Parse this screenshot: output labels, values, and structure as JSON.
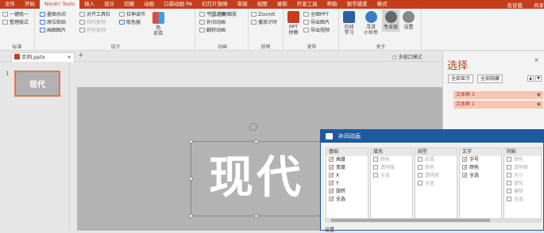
{
  "menu": {
    "tabs": [
      "文件",
      "开始",
      "Nordri Tools",
      "插入",
      "设计",
      "切换",
      "动画",
      "口袋动画 PA",
      "幻灯片放映",
      "审阅",
      "视图",
      "录制",
      "开发工具",
      "帮助",
      "银币猎爱",
      "格式"
    ],
    "active_index": 2,
    "tell_me": "告诉我",
    "share": "共享"
  },
  "ribbon": {
    "g1": {
      "label": "标准",
      "items": [
        "一键统一",
        "整理版式"
      ]
    },
    "g2": {
      "label": "设计",
      "items": [
        "墨图水印",
        "原位粘贴",
        "画图图片",
        "对齐工具栏",
        "矩阵复制",
        "环形复制",
        "拉伸调节",
        "取色器"
      ],
      "big": "色\n彩库"
    },
    "g3": {
      "label": "动画",
      "items": [
        "平滑过渡",
        "补间动画",
        "翻转动画",
        "时间缩放"
      ]
    },
    "g4": {
      "label": "放映",
      "items": [
        "ZoomIt",
        "播放计时"
      ]
    },
    "g5": {
      "label": "发布",
      "big": "PPT\n拼图",
      "items": [
        "全图PPT",
        "导出图片",
        "导出视频"
      ]
    },
    "g6": {
      "label": "关于",
      "items": [
        "在线\n学习",
        "寻求\n小伙伴",
        "专业版",
        "设置"
      ]
    }
  },
  "doc": {
    "tab_label": "实例.pptx",
    "add_tab": "+",
    "slide_number": "1",
    "thumb_text": "现代",
    "slide_text": "现代",
    "multi_window": "多窗口模式"
  },
  "selection_pane": {
    "title": "选择",
    "show_all": "全部显示",
    "hide_all": "全部隐藏",
    "items": [
      "文本框 3",
      "文本框 1"
    ]
  },
  "dialog": {
    "title": "补间动画",
    "columns": [
      {
        "header": "基础",
        "rows": [
          {
            "t": "高度",
            "on": true
          },
          {
            "t": "宽度",
            "on": true
          },
          {
            "t": "X",
            "on": true
          },
          {
            "t": "Y",
            "on": true
          },
          {
            "t": "旋转",
            "on": true
          },
          {
            "t": "全选",
            "on": true
          }
        ]
      },
      {
        "header": "填充",
        "rows": [
          {
            "t": "颜色",
            "on": false
          },
          {
            "t": "透明度",
            "on": false
          },
          {
            "t": "全选",
            "on": false
          }
        ]
      },
      {
        "header": "线型",
        "rows": [
          {
            "t": "线宽",
            "on": false
          },
          {
            "t": "颜色",
            "on": false
          },
          {
            "t": "透明度",
            "on": false
          },
          {
            "t": "全选",
            "on": false
          }
        ]
      },
      {
        "header": "文字",
        "rows": [
          {
            "t": "字号",
            "on": true
          },
          {
            "t": "颜色",
            "on": true
          },
          {
            "t": "全选",
            "on": true
          }
        ]
      },
      {
        "header": "阴影",
        "rows": [
          {
            "t": "颜色",
            "on": false
          },
          {
            "t": "透明度",
            "on": false
          },
          {
            "t": "大小",
            "on": false
          },
          {
            "t": "虚化",
            "on": false
          },
          {
            "t": "偏移",
            "on": false
          },
          {
            "t": "全选",
            "on": false
          }
        ]
      }
    ],
    "footer": "设置"
  }
}
